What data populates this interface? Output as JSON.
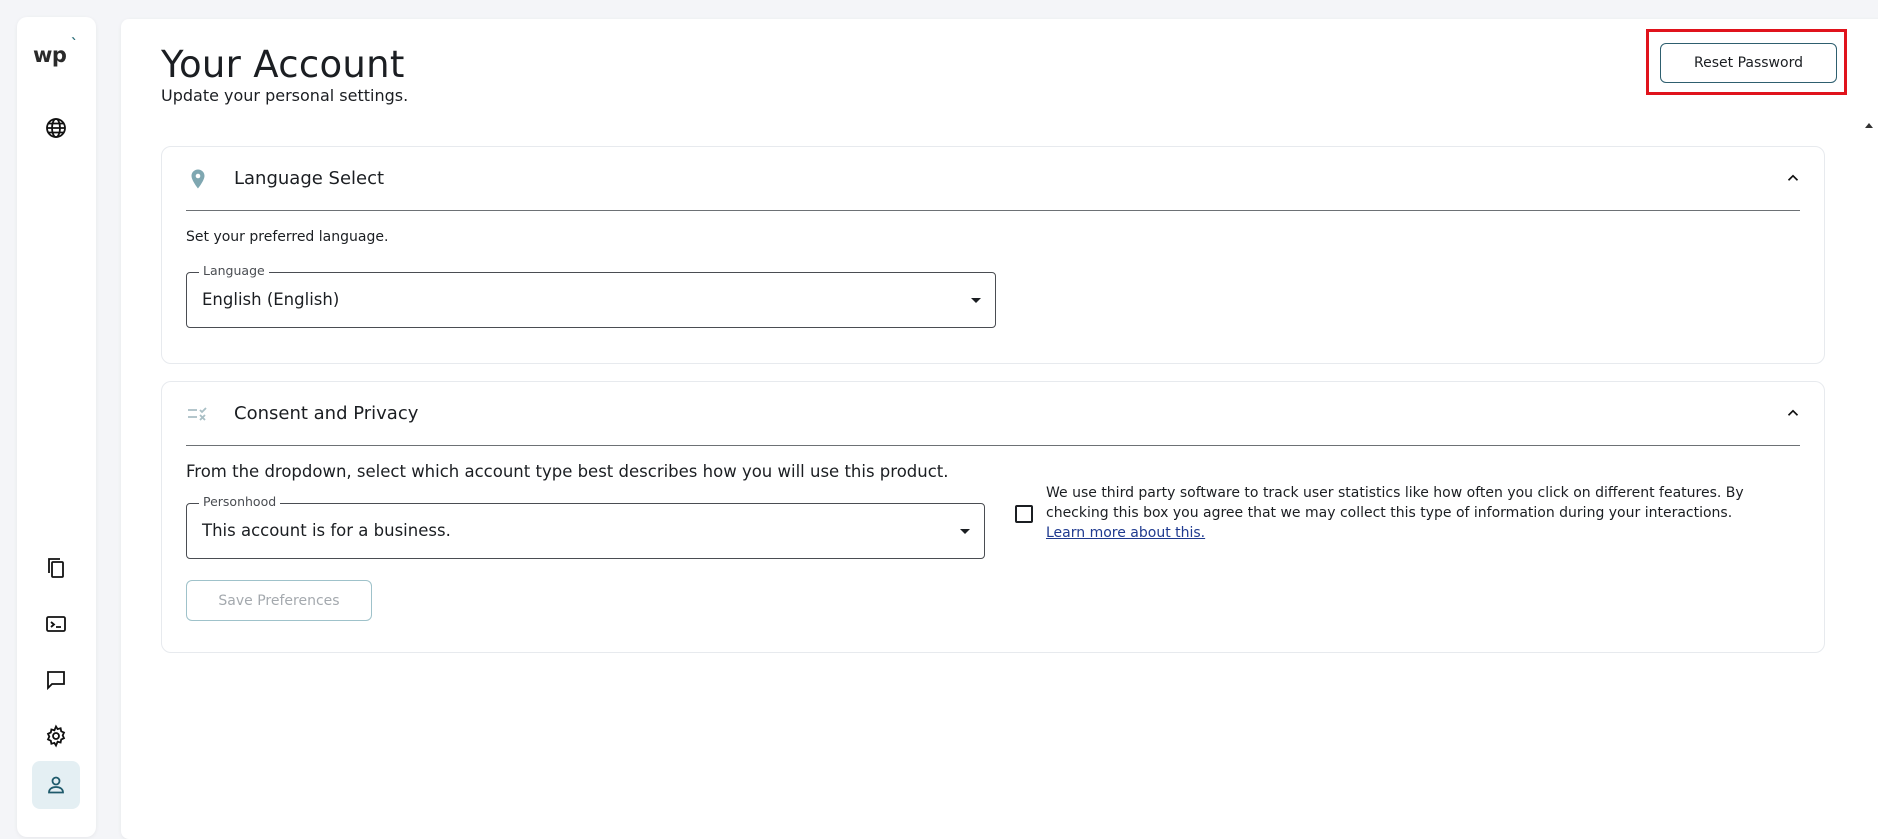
{
  "brand": {
    "logo_text": "wp"
  },
  "sidebar": {
    "top_items": [
      {
        "icon": "globe-icon"
      }
    ],
    "bottom_items": [
      {
        "icon": "documents-icon"
      },
      {
        "icon": "terminal-icon"
      },
      {
        "icon": "chat-icon"
      },
      {
        "icon": "gear-icon"
      },
      {
        "icon": "user-icon",
        "active": true
      }
    ]
  },
  "header": {
    "title": "Your Account",
    "subtitle": "Update your personal settings.",
    "reset_password_label": "Reset Password"
  },
  "language_section": {
    "title": "Language Select",
    "icon": "location-pin-icon",
    "description": "Set your preferred language.",
    "field_label": "Language",
    "field_value": "English (English)"
  },
  "consent_section": {
    "title": "Consent and Privacy",
    "icon": "checklist-icon",
    "description": "From the dropdown, select which account type best describes how you will use this product.",
    "field_label": "Personhood",
    "field_value": "This account is for a business.",
    "consent_text": "We use third party software to track user statistics like how often you click on different features. By checking this box you agree that we may collect this type of information during your interactions.",
    "consent_link": "Learn more about this.",
    "consent_checked": false,
    "save_label": "Save Preferences"
  },
  "colors": {
    "accent": "#2e5f6f",
    "active_nav_bg": "#e4eff3",
    "highlight_box": "#e0131c",
    "link": "#1f3a8f"
  }
}
